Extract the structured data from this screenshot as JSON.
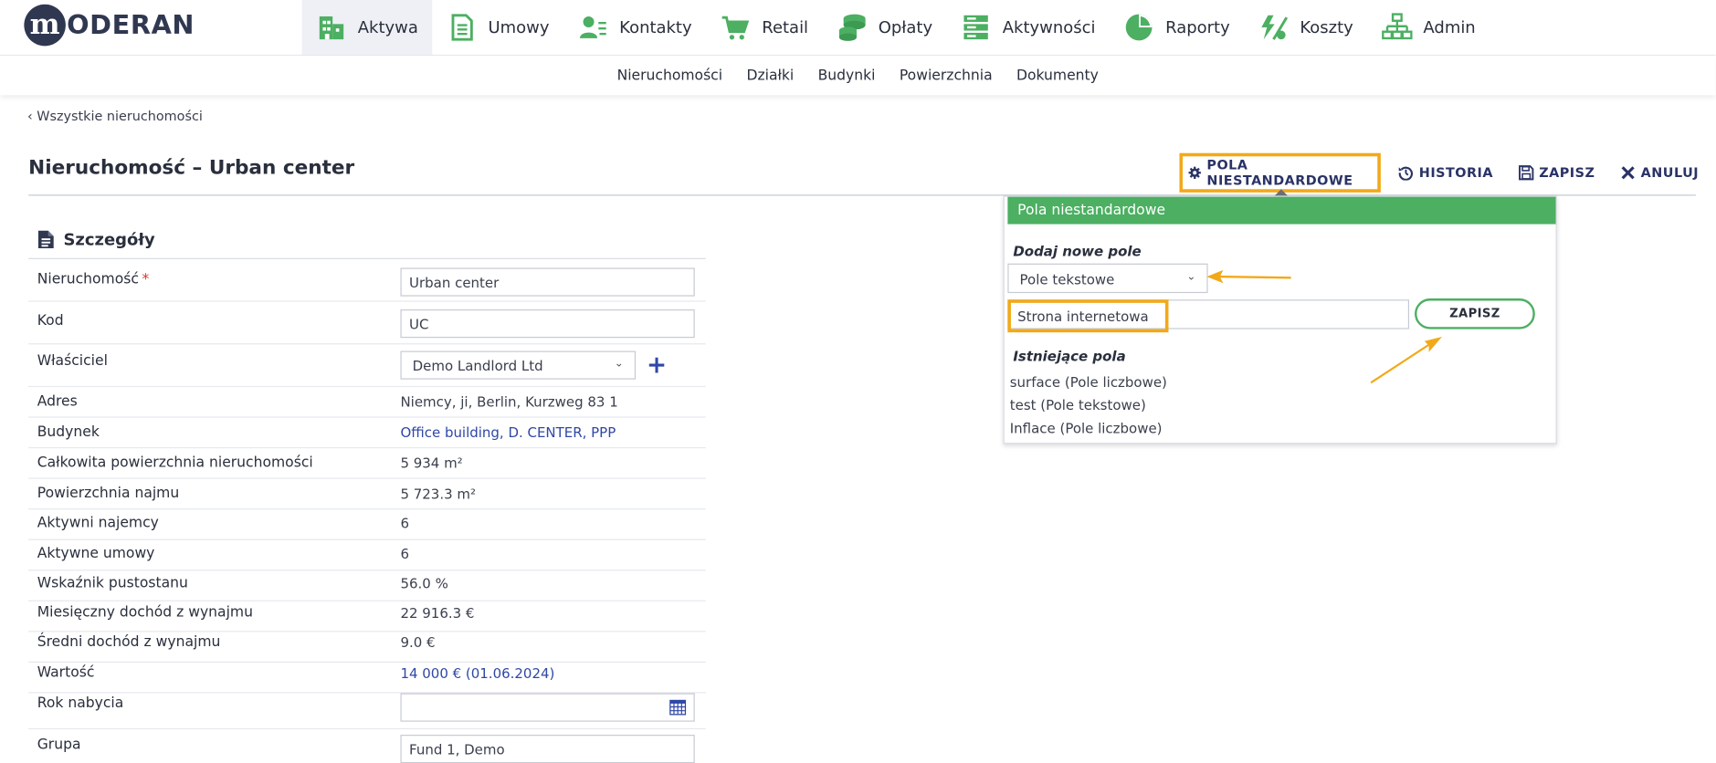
{
  "app": {
    "logo_letter": "m",
    "logo_text": "ODERAN"
  },
  "colors": {
    "accent_green": "#4caf62",
    "brand_navy": "#303851",
    "link_blue": "#2f47a6",
    "highlight_orange": "#f2a919"
  },
  "nav": {
    "items": [
      {
        "label": "Aktywa",
        "icon": "buildings-icon"
      },
      {
        "label": "Umowy",
        "icon": "document-icon"
      },
      {
        "label": "Kontakty",
        "icon": "contacts-icon"
      },
      {
        "label": "Retail",
        "icon": "cart-icon"
      },
      {
        "label": "Opłaty",
        "icon": "coins-icon"
      },
      {
        "label": "Aktywności",
        "icon": "tasks-icon"
      },
      {
        "label": "Raporty",
        "icon": "pie-chart-icon"
      },
      {
        "label": "Koszty",
        "icon": "costs-icon"
      },
      {
        "label": "Admin",
        "icon": "sitemap-icon"
      }
    ],
    "active": "Aktywa"
  },
  "subnav": [
    "Nieruchomości",
    "Działki",
    "Budynki",
    "Powierzchnia",
    "Dokumenty"
  ],
  "breadcrumb": "‹ Wszystkie nieruchomości",
  "page_title": "Nieruchomość – Urban center",
  "actions": {
    "custom_fields": "POLA NIESTANDARDOWE",
    "history": "HISTORIA",
    "save": "ZAPISZ",
    "cancel": "ANULUJ"
  },
  "details": {
    "heading": "Szczegóły",
    "property_label": "Nieruchomość",
    "property_required": "*",
    "property_value": "Urban center",
    "code_label": "Kod",
    "code_value": "UC",
    "owner_label": "Właściciel",
    "owner_value": "Demo Landlord Ltd",
    "address_label": "Adres",
    "address_value": "Niemcy, ji, Berlin, Kurzweg 83 1",
    "building_label": "Budynek",
    "building_value": "Office building, D. CENTER, PPP",
    "total_area_label": "Całkowita powierzchnia nieruchomości",
    "total_area_value": "5 934 m²",
    "rent_area_label": "Powierzchnia najmu",
    "rent_area_value": "5 723.3 m²",
    "active_tenants_label": "Aktywni najemcy",
    "active_tenants_value": "6",
    "active_contracts_label": "Aktywne umowy",
    "active_contracts_value": "6",
    "vacancy_label": "Wskaźnik pustostanu",
    "vacancy_value": "56.0 %",
    "monthly_income_label": "Miesięczny dochód z wynajmu",
    "monthly_income_value": "22 916.3 €",
    "avg_income_label": "Średni dochód z wynajmu",
    "avg_income_value": "9.0 €",
    "value_label": "Wartość",
    "value_value": "14 000 € (01.06.2024)",
    "acquisition_year_label": "Rok nabycia",
    "acquisition_year_value": "",
    "group_label": "Grupa",
    "group_value": "Fund 1, Demo"
  },
  "popup": {
    "title": "Pola niestandardowe",
    "add_new_label": "Dodaj nowe pole",
    "field_type": "Pole tekstowe",
    "field_name": "Strona internetowa",
    "save_button": "ZAPISZ",
    "existing_label": "Istniejące pola",
    "existing": [
      "surface (Pole liczbowe)",
      "test (Pole tekstowe)",
      "Inflace (Pole liczbowe)"
    ]
  }
}
